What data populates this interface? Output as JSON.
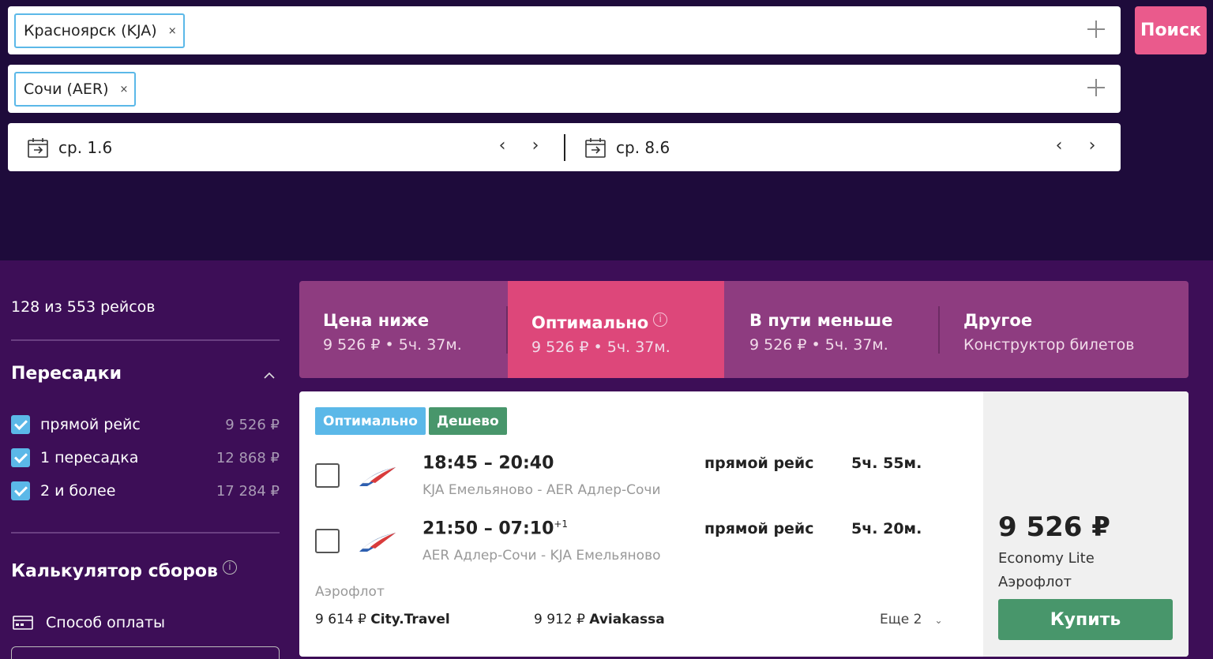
{
  "search": {
    "origin_chip": "Красноярск (KJA)",
    "destination_chip": "Сочи (AER)",
    "chip_remove": "×",
    "depart_date": "ср. 1.6",
    "return_date": "ср. 8.6",
    "prev_arrow": "‹",
    "next_arrow": "›",
    "search_label": "Поиск"
  },
  "sidebar": {
    "count_text": "128 из 553 рейсов",
    "transfers_title": "Пересадки",
    "filters": [
      {
        "label": "прямой рейс",
        "price": "9 526 ₽",
        "checked": true
      },
      {
        "label": "1 пересадка",
        "price": "12 868 ₽",
        "checked": true
      },
      {
        "label": "2 и более",
        "price": "17 284 ₽",
        "checked": true
      }
    ],
    "calculator_title": "Калькулятор сборов",
    "info_glyph": "i",
    "payment_label": "Способ оплаты"
  },
  "tabs": [
    {
      "title": "Цена ниже",
      "sub": "9 526 ₽ • 5ч. 37м.",
      "active": false
    },
    {
      "title": "Оптимально",
      "sub": "9 526 ₽ • 5ч. 37м.",
      "active": true
    },
    {
      "title": "В пути меньше",
      "sub": "9 526 ₽ • 5ч. 37м.",
      "active": false
    },
    {
      "title": "Другое",
      "sub": "Конструктор билетов",
      "active": false
    }
  ],
  "result": {
    "badges": [
      "Оптимально",
      "Дешево"
    ],
    "segments": [
      {
        "time": "18:45 – 20:40",
        "plus_day": "",
        "route": "KJA Емельяново - AER Адлер-Сочи",
        "type": "прямой рейс",
        "duration": "5ч. 55м."
      },
      {
        "time": "21:50 – 07:10",
        "plus_day": "+1",
        "route": "AER Адлер-Сочи - KJA Емельяново",
        "type": "прямой рейс",
        "duration": "5ч. 20м."
      }
    ],
    "airline": "Аэрофлот",
    "agents": [
      {
        "price": "9 614 ₽",
        "name": "City.Travel"
      },
      {
        "price": "9 912 ₽",
        "name": "Aviakassa"
      }
    ],
    "more_label": "Еще 2",
    "price": "9 526 ₽",
    "fare": "Economy Lite",
    "carrier": "Аэрофлот",
    "buy_label": "Купить"
  },
  "colors": {
    "header_bg": "#1e0b3b",
    "content_bg": "#3d0e57",
    "accent_pink": "#ea5a8c",
    "tab_bg": "#8e3c80",
    "tab_active": "#dd477a",
    "badge_blue": "#5bb8e8",
    "green": "#48966b"
  }
}
